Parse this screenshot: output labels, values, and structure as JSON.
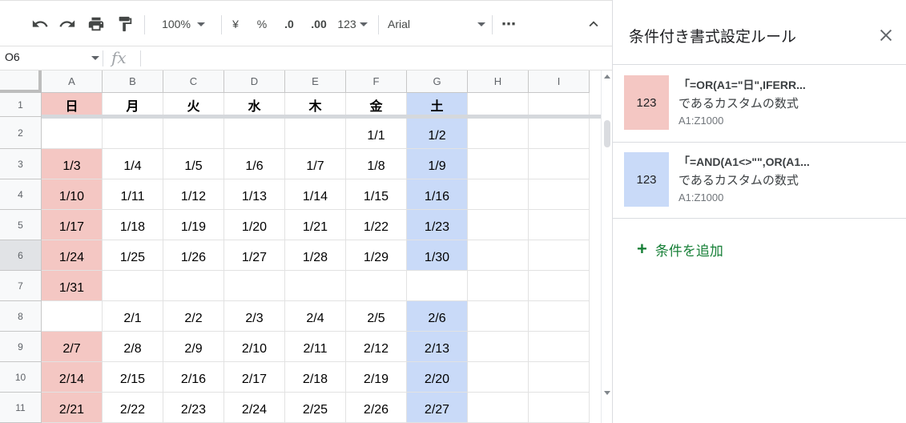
{
  "toolbar": {
    "zoom": "100%",
    "currency": "¥",
    "percent": "%",
    "decimal_decrease": ".0",
    "decimal_increase": ".00",
    "number_format": "123",
    "font": "Arial",
    "more": "⋯",
    "collapse": "∧"
  },
  "formula_bar": {
    "name_box": "O6",
    "fx": "fx",
    "content": ""
  },
  "grid": {
    "columns": [
      "A",
      "B",
      "C",
      "D",
      "E",
      "F",
      "G",
      "H",
      "I"
    ],
    "rows": [
      "1",
      "2",
      "3",
      "4",
      "5",
      "6",
      "7",
      "8",
      "9",
      "10",
      "11"
    ],
    "selected_row": "6",
    "cells": [
      [
        "日",
        "月",
        "火",
        "水",
        "木",
        "金",
        "土",
        "",
        ""
      ],
      [
        "",
        "",
        "",
        "",
        "",
        "1/1",
        "1/2",
        "",
        ""
      ],
      [
        "1/3",
        "1/4",
        "1/5",
        "1/6",
        "1/7",
        "1/8",
        "1/9",
        "",
        ""
      ],
      [
        "1/10",
        "1/11",
        "1/12",
        "1/13",
        "1/14",
        "1/15",
        "1/16",
        "",
        ""
      ],
      [
        "1/17",
        "1/18",
        "1/19",
        "1/20",
        "1/21",
        "1/22",
        "1/23",
        "",
        ""
      ],
      [
        "1/24",
        "1/25",
        "1/26",
        "1/27",
        "1/28",
        "1/29",
        "1/30",
        "",
        ""
      ],
      [
        "1/31",
        "",
        "",
        "",
        "",
        "",
        "",
        "",
        ""
      ],
      [
        "",
        "2/1",
        "2/2",
        "2/3",
        "2/4",
        "2/5",
        "2/6",
        "",
        ""
      ],
      [
        "2/7",
        "2/8",
        "2/9",
        "2/10",
        "2/11",
        "2/12",
        "2/13",
        "",
        ""
      ],
      [
        "2/14",
        "2/15",
        "2/16",
        "2/17",
        "2/18",
        "2/19",
        "2/20",
        "",
        ""
      ],
      [
        "2/21",
        "2/22",
        "2/23",
        "2/24",
        "2/25",
        "2/26",
        "2/27",
        "",
        ""
      ]
    ],
    "sunday_fill": "#f4c7c3",
    "saturday_fill": "#c9daf8"
  },
  "panel": {
    "title": "条件付き書式設定ルール",
    "rules": [
      {
        "preview": "123",
        "formula": "「=OR(A1=\"日\",IFERR...",
        "description": "であるカスタムの数式",
        "range": "A1:Z1000",
        "color": "#f4c7c3"
      },
      {
        "preview": "123",
        "formula": "「=AND(A1<>\"\",OR(A1...",
        "description": "であるカスタムの数式",
        "range": "A1:Z1000",
        "color": "#c9daf8"
      }
    ],
    "add_rule": "条件を追加"
  }
}
